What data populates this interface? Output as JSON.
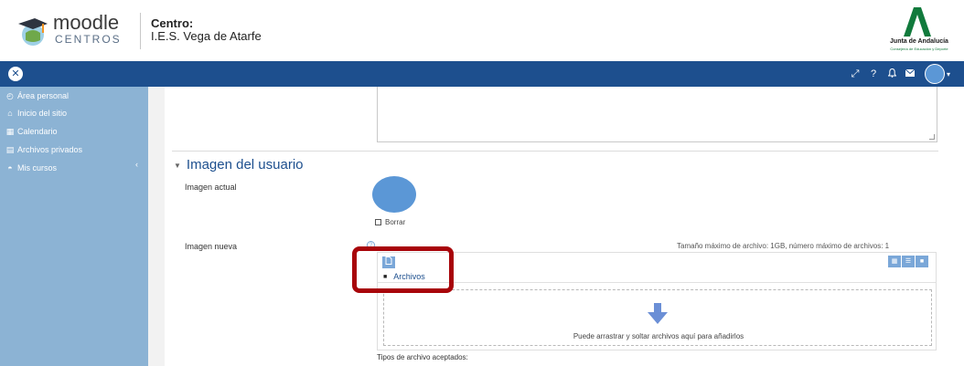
{
  "brand": {
    "logo_text": "moodle",
    "logo_sub": "CENTROS",
    "centro_label": "Centro:",
    "centro_name": "I.E.S. Vega de Atarfe",
    "junta_text": "Junta de Andalucía",
    "junta_sub": "Consejería de Educación y Deporte"
  },
  "navbar": {
    "close_glyph": "✕",
    "icons": [
      "expand-icon",
      "help-icon",
      "bell-icon",
      "envelope-icon"
    ],
    "icon_glyphs": [
      "⤢",
      "?",
      "🔔",
      "✉"
    ],
    "caret": "▾"
  },
  "sidebar": {
    "items": [
      {
        "label": "Área personal",
        "icon": "dashboard-icon",
        "glyph": "◴"
      },
      {
        "label": "Inicio del sitio",
        "icon": "home-icon",
        "glyph": "⌂"
      },
      {
        "label": "Calendario",
        "icon": "calendar-icon",
        "glyph": "▦"
      },
      {
        "label": "Archivos privados",
        "icon": "files-icon",
        "glyph": "▤"
      },
      {
        "label": "Mis cursos",
        "icon": "graduation-cap-icon",
        "glyph": "◓"
      }
    ],
    "collapse_caret": "‹"
  },
  "section": {
    "title": "Imagen del usuario",
    "current_image_label": "Imagen actual",
    "delete_label": "Borrar",
    "new_image_label": "Imagen nueva",
    "max_size_text": "Tamaño máximo de archivo: 1GB, número máximo de archivos: 1"
  },
  "filepicker": {
    "folder_link": "Archivos",
    "drop_text": "Puede arrastrar y soltar archivos aquí para añadirlos",
    "accepted_types_label": "Tipos de archivo aceptados:"
  },
  "colors": {
    "navbar": "#1d4f8e",
    "sidebar": "#8cb3d4",
    "avatar": "#5b97d6",
    "highlight": "#a8050a"
  }
}
